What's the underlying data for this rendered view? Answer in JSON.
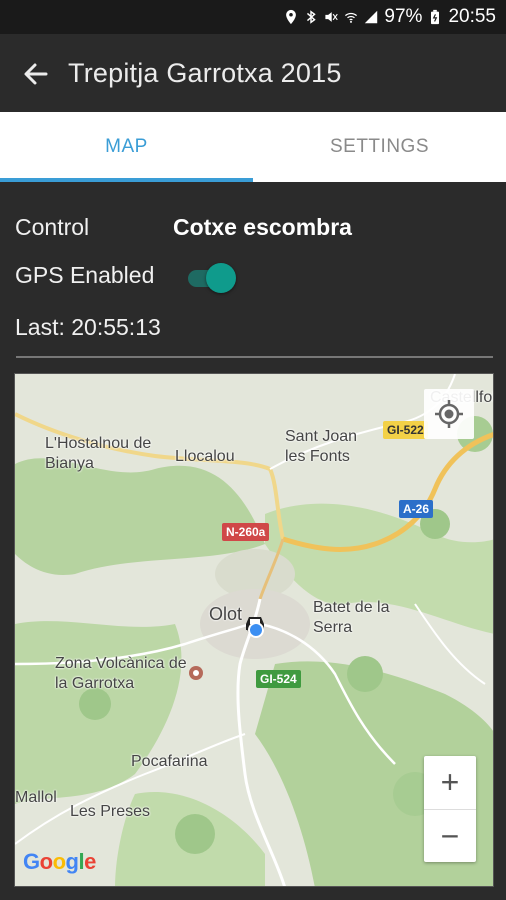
{
  "status_bar": {
    "battery_percent": "97%",
    "time": "20:55"
  },
  "app_bar": {
    "title": "Trepitja Garrotxa 2015"
  },
  "tabs": [
    {
      "label": "MAP",
      "active": true
    },
    {
      "label": "SETTINGS",
      "active": false
    }
  ],
  "content": {
    "control_label": "Control",
    "control_value": "Cotxe escombra",
    "gps_label": "GPS Enabled",
    "gps_enabled": true,
    "last_update": "Last: 20:55:13"
  },
  "map": {
    "places": [
      "Castellfollit de la Roca",
      "L'Hostalnou de Bianya",
      "Llocalou",
      "Sant Joan les Fonts",
      "Olot",
      "Batet de la Serra",
      "Zona Volcànica de la Garrotxa",
      "Pocafarina",
      "Mallol",
      "Les Preses"
    ],
    "roads": [
      "GI-522",
      "A-26",
      "N-260a",
      "GI-524"
    ],
    "zoom_in_label": "+",
    "zoom_out_label": "−",
    "attribution": "Google"
  },
  "colors": {
    "accent": "#3a9dd6",
    "toggle_on": "#0f9b8c",
    "background": "#2b2b2b"
  }
}
